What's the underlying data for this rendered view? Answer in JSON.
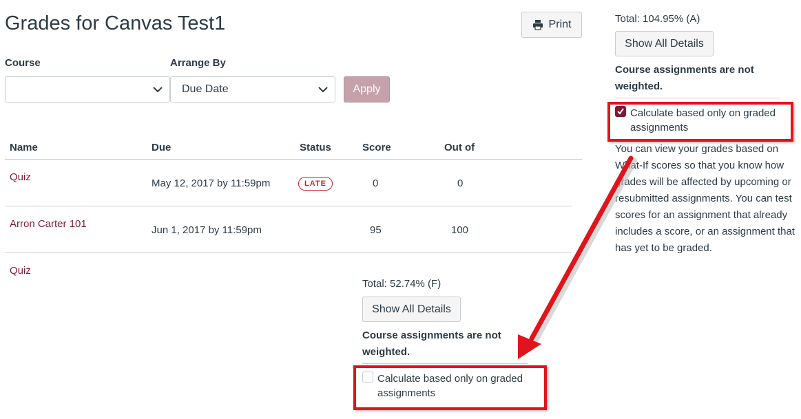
{
  "header": {
    "title": "Grades for Canvas Test1",
    "print_label": "Print",
    "print_icon": "printer-icon"
  },
  "filters": {
    "course_label": "Course",
    "course_value": "",
    "arrange_label": "Arrange By",
    "arrange_value": "Due Date",
    "apply_label": "Apply"
  },
  "table": {
    "columns": [
      "Name",
      "Due",
      "Status",
      "Score",
      "Out of"
    ],
    "rows": [
      {
        "name": "Quiz",
        "due": "May 12, 2017 by 11:59pm",
        "status": "LATE",
        "score": "0",
        "out_of": "0"
      },
      {
        "name": "Arron Carter 101",
        "due": "Jun 1, 2017 by 11:59pm",
        "status": "",
        "score": "95",
        "out_of": "100"
      },
      {
        "name": "Quiz",
        "due": "",
        "status": "",
        "score": "",
        "out_of": ""
      }
    ]
  },
  "lower_panel": {
    "total": "Total: 52.74% (F)",
    "show_details_label": "Show All Details",
    "weight_note": "Course assignments are not weighted.",
    "checkbox_label": "Calculate based only on graded assignments",
    "checkbox_checked": false
  },
  "sidebar": {
    "total": "Total: 104.95% (A)",
    "show_details_label": "Show All Details",
    "weight_note": "Course assignments are not weighted.",
    "checkbox_label": "Calculate based only on graded assignments",
    "checkbox_checked": true,
    "description": "You can view your grades based on What-If scores so that you know how grades will be affected by upcoming or resubmitted assignments. You can test scores for an assignment that already includes a score, or an assignment that has yet to be graded."
  },
  "colors": {
    "link": "#7e1b34",
    "late_badge": "#c4242b",
    "apply_button": "#c5a1ab",
    "annotation": "#e0141c"
  }
}
